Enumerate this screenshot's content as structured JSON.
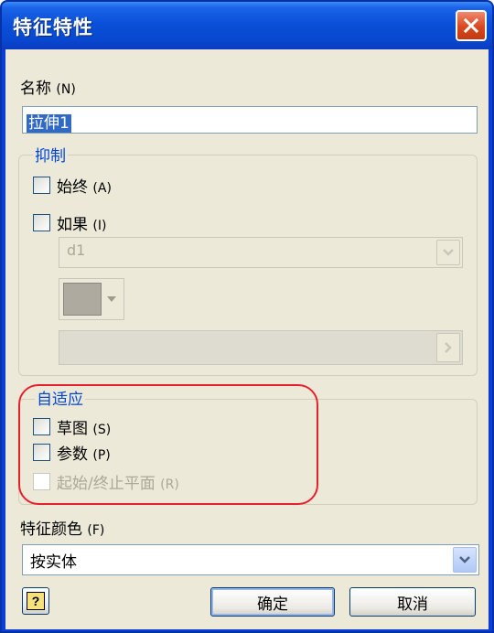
{
  "window": {
    "title": "特征特性"
  },
  "name_field": {
    "label": "名称",
    "accel": "(N)",
    "value": "拉伸1"
  },
  "suppress": {
    "title": "抑制",
    "always": {
      "label": "始终",
      "accel": "(A)"
    },
    "if": {
      "label": "如果",
      "accel": "(I)"
    },
    "parameter_combo_value": "d1"
  },
  "adaptive": {
    "title": "自适应",
    "sketch": {
      "label": "草图",
      "accel": "(S)"
    },
    "parameters": {
      "label": "参数",
      "accel": "(P)"
    },
    "start_stop_plane": {
      "label": "起始/终止平面",
      "accel": "(R)"
    }
  },
  "feature_color": {
    "label": "特征颜色",
    "accel": "(F)",
    "value": "按实体"
  },
  "buttons": {
    "ok": "确定",
    "cancel": "取消",
    "help": "?"
  },
  "colors": {
    "titlebar": "#0a50d8",
    "group_title": "#0046d5",
    "highlight_outline": "#e8202e",
    "selection": "#316ac5",
    "dialog_background": "#ece9d8"
  },
  "icons": {
    "close": "close-x-icon",
    "combo_dropdown": "chevron-down-icon",
    "slider": "chevron-right-icon",
    "help": "help-question-icon"
  }
}
